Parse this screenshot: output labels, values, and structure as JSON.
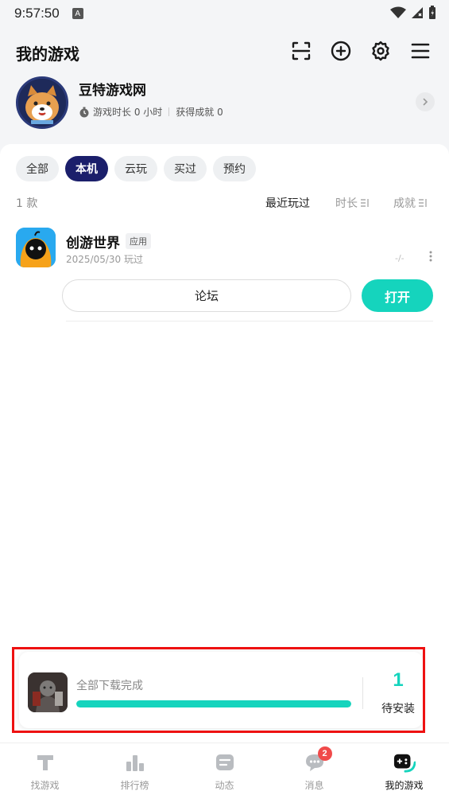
{
  "status_bar": {
    "time": "9:57:50",
    "notification_letter": "A"
  },
  "header": {
    "title": "我的游戏"
  },
  "profile": {
    "name": "豆特游戏网",
    "playtime": "游戏时长 0 小时",
    "achievements": "获得成就 0"
  },
  "tabs": [
    {
      "label": "全部",
      "active": false
    },
    {
      "label": "本机",
      "active": true
    },
    {
      "label": "云玩",
      "active": false
    },
    {
      "label": "买过",
      "active": false
    },
    {
      "label": "预约",
      "active": false
    }
  ],
  "sort": {
    "count": "1 款",
    "recent": "最近玩过",
    "duration": "时长",
    "achievement": "成就"
  },
  "games": [
    {
      "name": "创游世界",
      "badge": "应用",
      "last_played": "2025/05/30 玩过",
      "dash": "-/-",
      "forum_label": "论坛",
      "open_label": "打开"
    }
  ],
  "download": {
    "status": "全部下载完成",
    "progress": 1.0,
    "pending_count": "1",
    "pending_label": "待安装"
  },
  "nav": [
    {
      "label": "找游戏",
      "icon": "find-game-icon"
    },
    {
      "label": "排行榜",
      "icon": "ranking-icon"
    },
    {
      "label": "动态",
      "icon": "feed-icon"
    },
    {
      "label": "消息",
      "icon": "message-icon",
      "badge": "2"
    },
    {
      "label": "我的游戏",
      "icon": "my-games-icon",
      "active": true
    }
  ],
  "colors": {
    "accent": "#15d4bd",
    "tab_active": "#1b1f6b",
    "badge_red": "#f04a4a"
  }
}
